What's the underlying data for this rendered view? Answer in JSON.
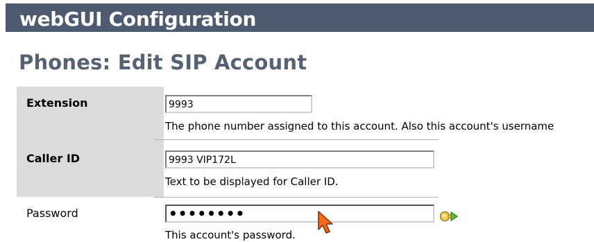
{
  "header": {
    "title": "webGUI Configuration"
  },
  "page": {
    "title": "Phones: Edit SIP Account"
  },
  "form": {
    "extension": {
      "label": "Extension",
      "value": "9993",
      "description": "The phone number assigned to this account. Also this account's username"
    },
    "caller_id": {
      "label": "Caller ID",
      "value": "9993 VIP172L",
      "description": "Text to be displayed for Caller ID."
    },
    "password": {
      "label": "Password",
      "masked_value": "••••••••",
      "description": "This account's password.",
      "generate_icon": "key-generate-icon"
    }
  },
  "colors": {
    "header_bg": "#4d5a6f",
    "title_color": "#566171",
    "label_bg": "#dcdcdc",
    "cursor": "#f26b1d"
  }
}
